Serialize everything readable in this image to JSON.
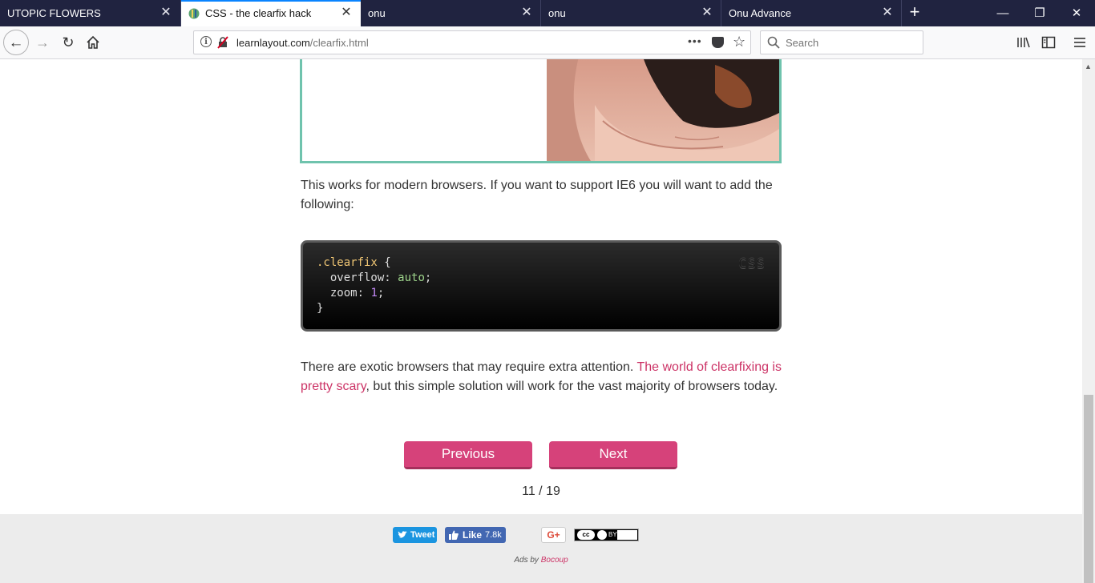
{
  "browser": {
    "tabs": [
      {
        "title": "UTOPIC FLOWERS"
      },
      {
        "title": "CSS - the clearfix hack"
      },
      {
        "title": "onu"
      },
      {
        "title": "onu"
      },
      {
        "title": "Onu Advance"
      }
    ],
    "new_tab_glyph": "+",
    "url_host": "learnlayout.com",
    "url_path": "/clearfix.html",
    "page_actions_glyph": "•••",
    "search_placeholder": "Search"
  },
  "content": {
    "para1": "This works for modern browsers. If you want to support IE6 you will want to add the following:",
    "code": {
      "language": "CSS",
      "selector": ".clearfix",
      "open_brace": " {",
      "prop1": "  overflow: ",
      "val1": "auto",
      "prop2": "  zoom: ",
      "val2": "1",
      "close_brace": "}",
      "semicolon": ";"
    },
    "para2_start": "There are exotic browsers that may require extra attention. ",
    "para2_link": "The world of clearfixing is pretty scary",
    "para2_end": ", but this simple solution will work for the vast majority of browsers today.",
    "prev_label": "Previous",
    "next_label": "Next",
    "pager": "11 / 19"
  },
  "footer": {
    "tweet_label": "Tweet",
    "like_label": "Like",
    "like_count": "7.8k",
    "gplus_label": "G+",
    "cc_label": "cc",
    "cc_by": "BY",
    "ads_prefix": "Ads by ",
    "ads_link": "Bocoup"
  },
  "colors": {
    "tabstrip": "#202340",
    "accent": "#0a84ff",
    "link": "#cc3366",
    "button": "#d6427a",
    "figure_border": "#6fc3ad"
  },
  "icons": [
    "back-icon",
    "forward-icon",
    "reload-icon",
    "home-icon",
    "info-icon",
    "insecure-icon",
    "pocket-icon",
    "bookmark-star-icon",
    "search-icon",
    "library-icon",
    "sidebar-icon",
    "menu-icon"
  ]
}
